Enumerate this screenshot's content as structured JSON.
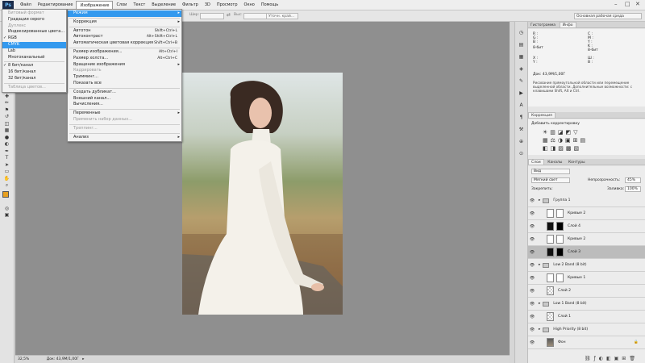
{
  "menubar": {
    "logo": "Ps",
    "items": [
      "Файл",
      "Редактирование",
      "Изображение",
      "Слои",
      "Текст",
      "Выделение",
      "Фильтр",
      "3D",
      "Просмотр",
      "Окно",
      "Помощь"
    ],
    "active_index": 2
  },
  "options_bar": {
    "field1": "Шир:",
    "field2": "Выс:",
    "button": "Уточн. край...",
    "workspace": "Основная рабочая среда"
  },
  "image_menu": [
    {
      "label": "Режим",
      "arrow": true,
      "selected": true
    },
    {
      "sep": true
    },
    {
      "label": "Коррекция",
      "arrow": true
    },
    {
      "sep": true
    },
    {
      "label": "Автотон",
      "shortcut": "Shift+Ctrl+L"
    },
    {
      "label": "Автоконтраст",
      "shortcut": "Alt+Shift+Ctrl+L"
    },
    {
      "label": "Автоматическая цветовая коррекция",
      "shortcut": "Shift+Ctrl+B"
    },
    {
      "sep": true
    },
    {
      "label": "Размер изображения...",
      "shortcut": "Alt+Ctrl+I"
    },
    {
      "label": "Размер холста...",
      "shortcut": "Alt+Ctrl+C"
    },
    {
      "label": "Вращение изображения",
      "arrow": true
    },
    {
      "label": "Кадрировать",
      "disabled": true
    },
    {
      "label": "Тримминг..."
    },
    {
      "label": "Показать все"
    },
    {
      "sep": true
    },
    {
      "label": "Создать дубликат..."
    },
    {
      "label": "Внешний канал..."
    },
    {
      "label": "Вычисления..."
    },
    {
      "sep": true
    },
    {
      "label": "Переменные",
      "arrow": true
    },
    {
      "label": "Применить набор данных...",
      "disabled": true
    },
    {
      "sep": true
    },
    {
      "label": "Треппинг...",
      "disabled": true
    },
    {
      "sep": true
    },
    {
      "label": "Анализ",
      "arrow": true
    }
  ],
  "mode_menu": [
    {
      "label": "Битовый формат",
      "disabled": true
    },
    {
      "label": "Градации серого"
    },
    {
      "label": "Дуплекс",
      "disabled": true
    },
    {
      "label": "Индексированные цвета..."
    },
    {
      "label": "RGB",
      "check": true
    },
    {
      "label": "CMYK",
      "selected": true
    },
    {
      "label": "Lab"
    },
    {
      "label": "Многоканальный"
    },
    {
      "sep": true
    },
    {
      "label": "8 бит/канал",
      "check": true
    },
    {
      "label": "16 бит/канал"
    },
    {
      "label": "32 бит/канал"
    },
    {
      "sep": true
    },
    {
      "label": "Таблица цветов...",
      "disabled": true
    }
  ],
  "status": {
    "zoom": "32,5%",
    "doc": "Док: 43,9M/1,00Г"
  },
  "info_panel": {
    "tabs": [
      "Гистограмма",
      "Инфо"
    ],
    "r": "R :",
    "g": "G :",
    "b": "B :",
    "c": "C :",
    "m": "M :",
    "y": "Y :",
    "k": "K :",
    "bit1": "8-бит",
    "bit2": "8-бит",
    "x": "X :",
    "y2": "Y :",
    "w": "Ш :",
    "h": "В :",
    "doc": "Док: 43,9M/1,00Г",
    "hint": "Рисование прямоугольной области или перемещение выделенной области. Дополнительные возможности: с клавишами Shift, Alt и Ctrl."
  },
  "corrections_panel": {
    "title": "Коррекция",
    "subtitle": "Добавить корректировку"
  },
  "layers_panel": {
    "tabs": [
      "Слои",
      "Каналы",
      "Контуры"
    ],
    "kind": "Вид",
    "blend": "Мягкий свет",
    "opacity_label": "Непрозрачность:",
    "opacity": "45%",
    "lock_label": "Закрепить:",
    "fill_label": "Заливка:",
    "fill": "100%",
    "layers": [
      {
        "name": "Группа 1",
        "type": "folder"
      },
      {
        "name": "Кривые 2",
        "type": "adj"
      },
      {
        "name": "Слой 4",
        "type": "dark"
      },
      {
        "name": "Кривые 2",
        "type": "adj"
      },
      {
        "name": "Слой 3",
        "type": "dark",
        "selected": true
      },
      {
        "name": "Low 2 Band (8 bit)",
        "type": "folder"
      },
      {
        "name": "Кривые 1",
        "type": "adj"
      },
      {
        "name": "Слой 2",
        "type": "check"
      },
      {
        "name": "Low 1 Band (8 bit)",
        "type": "folder"
      },
      {
        "name": "Слой 1",
        "type": "check"
      },
      {
        "name": "High Priority (8 bit)",
        "type": "folder"
      },
      {
        "name": "Фон",
        "type": "img"
      }
    ]
  }
}
